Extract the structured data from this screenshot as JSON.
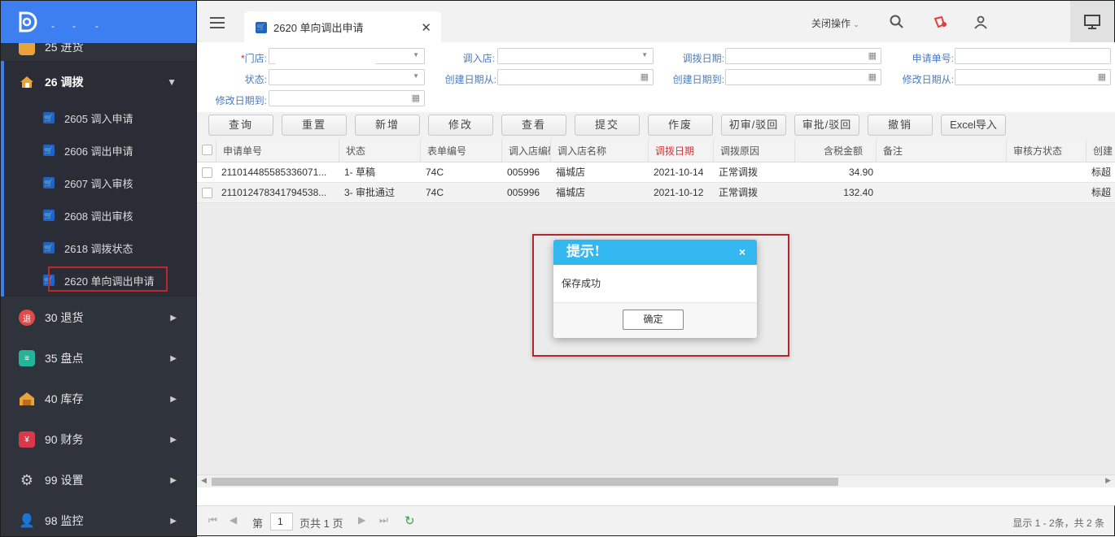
{
  "sidebar": {
    "partial_item": "25 进货",
    "groups": [
      {
        "label": "26 调拨",
        "icon": "transfer-icon",
        "open": true
      },
      {
        "label": "30 退货",
        "icon": "return-icon"
      },
      {
        "label": "35 盘点",
        "icon": "inventory-check-icon"
      },
      {
        "label": "40 库存",
        "icon": "warehouse-icon"
      },
      {
        "label": "90 财务",
        "icon": "finance-icon"
      },
      {
        "label": "99 设置",
        "icon": "gear-icon"
      },
      {
        "label": "98 监控",
        "icon": "monitor-user-icon"
      }
    ],
    "sub_items": [
      {
        "label": "2605 调入申请"
      },
      {
        "label": "2606 调出申请"
      },
      {
        "label": "2607 调入审核"
      },
      {
        "label": "2608 调出审核"
      },
      {
        "label": "2618 调拨状态"
      },
      {
        "label": "2620 单向调出申请"
      }
    ]
  },
  "topbar": {
    "tab_label": "2620 单向调出申请",
    "close_ops": "关闭操作"
  },
  "filter": {
    "store_label": "门店:",
    "store_required": "*",
    "in_store_label": "调入店:",
    "transfer_date_label": "调拨日期:",
    "apply_no_label": "申请单号:",
    "status_label": "状态:",
    "create_from_label": "创建日期从:",
    "create_to_label": "创建日期到:",
    "modify_from_label": "修改日期从:",
    "modify_to_label": "修改日期到:"
  },
  "toolbar": {
    "query": "查询",
    "reset": "重置",
    "add": "新增",
    "edit": "修改",
    "view": "查看",
    "submit": "提交",
    "void": "作废",
    "first_review": "初审/驳回",
    "approve": "审批/驳回",
    "revoke": "撤销",
    "excel_import": "Excel导入"
  },
  "grid": {
    "headers": [
      "申请单号",
      "状态",
      "表单编号",
      "调入店编码",
      "调入店名称",
      "调拨日期",
      "调拨原因",
      "含税金额",
      "备注",
      "审核方状态",
      "创建"
    ],
    "rows": [
      [
        "211014485585336071...",
        "1- 草稿",
        "74C",
        "005996",
        "福城店",
        "2021-10-14",
        "正常调拨",
        "34.90",
        "",
        "",
        "标超"
      ],
      [
        "211012478341794538...",
        "3- 审批通过",
        "74C",
        "005996",
        "福城店",
        "2021-10-12",
        "正常调拨",
        "132.40",
        "",
        "",
        "标超"
      ]
    ]
  },
  "pager": {
    "page_prefix": "第",
    "page_value": "1",
    "page_suffix": "页共 1 页",
    "info": "显示 1 - 2条，共 2 条"
  },
  "dialog": {
    "title": "提示!",
    "close": "×",
    "message": "保存成功",
    "ok": "确定"
  },
  "colors": {
    "sidebar_bg": "#2f333c",
    "accent": "#3d7ef0",
    "dialog_title": "#33b7f0",
    "highlight_red": "#c0272d",
    "sort_header_red": "#e03030"
  }
}
